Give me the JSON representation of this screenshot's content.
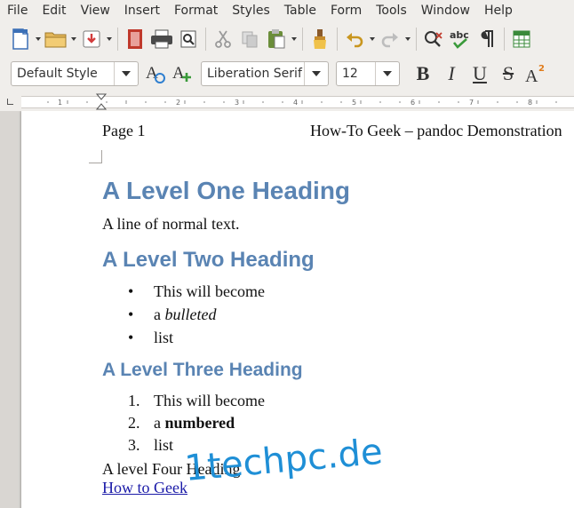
{
  "menu": [
    "File",
    "Edit",
    "View",
    "Insert",
    "Format",
    "Styles",
    "Table",
    "Form",
    "Tools",
    "Window",
    "Help"
  ],
  "toolbar2": {
    "paragraph_style": "Default Style",
    "font_name": "Liberation Serif",
    "font_size": "12"
  },
  "document": {
    "header_left": "Page 1",
    "header_right": "How-To Geek – pandoc Demonstration",
    "h1": "A Level One Heading",
    "normal_line": "A line of normal text.",
    "h2": "A Level Two Heading",
    "bullets": [
      {
        "pre": "This will become",
        "em": "",
        "post": ""
      },
      {
        "pre": "a ",
        "em": "bulleted",
        "post": ""
      },
      {
        "pre": "list",
        "em": "",
        "post": ""
      }
    ],
    "h3": "A Level Three Heading",
    "numbered": [
      {
        "num": "1.",
        "pre": "This will become",
        "strong": ""
      },
      {
        "num": "2.",
        "pre": "a ",
        "strong": "numbered"
      },
      {
        "num": "3.",
        "pre": "list",
        "strong": ""
      }
    ],
    "h4": "A level Four Heading",
    "link": "How to Geek"
  },
  "watermark": "1techpc.de"
}
